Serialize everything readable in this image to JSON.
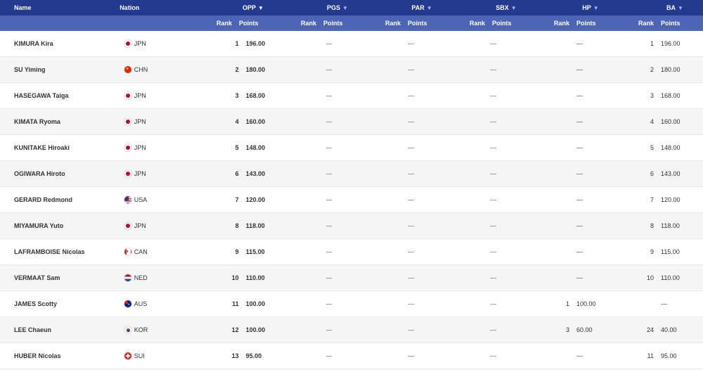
{
  "headers": {
    "name": "Name",
    "nation": "Nation",
    "events": [
      {
        "key": "OPP",
        "label": "OPP",
        "arrow": "▼",
        "active": true
      },
      {
        "key": "PGS",
        "label": "PGS",
        "arrow": "▼",
        "active": false
      },
      {
        "key": "PAR",
        "label": "PAR",
        "arrow": "▼",
        "active": false
      },
      {
        "key": "SBX",
        "label": "SBX",
        "arrow": "▼",
        "active": false
      },
      {
        "key": "HP",
        "label": "HP",
        "arrow": "▼",
        "active": false
      },
      {
        "key": "BA",
        "label": "BA",
        "arrow": "▼",
        "active": false
      }
    ],
    "rank": "Rank",
    "points": "Points"
  },
  "colors": {
    "header_dark": "#233a8f",
    "header_light": "#4e65b6",
    "row_alt": "#f5f5f5"
  },
  "rows": [
    {
      "name": "KIMURA Kira",
      "nation": "JPN",
      "flag": "jpn-flag-icon",
      "opp": [
        "1",
        "196.00"
      ],
      "pgs": "---",
      "par": "---",
      "sbx": "---",
      "hp": [
        "",
        "---"
      ],
      "ba": [
        "1",
        "196.00"
      ]
    },
    {
      "name": "SU Yiming",
      "nation": "CHN",
      "flag": "chn-flag-icon",
      "opp": [
        "2",
        "180.00"
      ],
      "pgs": "---",
      "par": "---",
      "sbx": "---",
      "hp": [
        "",
        "---"
      ],
      "ba": [
        "2",
        "180.00"
      ]
    },
    {
      "name": "HASEGAWA Taiga",
      "nation": "JPN",
      "flag": "jpn-flag-icon",
      "opp": [
        "3",
        "168.00"
      ],
      "pgs": "---",
      "par": "---",
      "sbx": "---",
      "hp": [
        "",
        "---"
      ],
      "ba": [
        "3",
        "168.00"
      ]
    },
    {
      "name": "KIMATA Ryoma",
      "nation": "JPN",
      "flag": "jpn-flag-icon",
      "opp": [
        "4",
        "160.00"
      ],
      "pgs": "---",
      "par": "---",
      "sbx": "---",
      "hp": [
        "",
        "---"
      ],
      "ba": [
        "4",
        "160.00"
      ]
    },
    {
      "name": "KUNITAKE Hiroaki",
      "nation": "JPN",
      "flag": "jpn-flag-icon",
      "opp": [
        "5",
        "148.00"
      ],
      "pgs": "---",
      "par": "---",
      "sbx": "---",
      "hp": [
        "",
        "---"
      ],
      "ba": [
        "5",
        "148.00"
      ]
    },
    {
      "name": "OGIWARA Hiroto",
      "nation": "JPN",
      "flag": "jpn-flag-icon",
      "opp": [
        "6",
        "143.00"
      ],
      "pgs": "---",
      "par": "---",
      "sbx": "---",
      "hp": [
        "",
        "---"
      ],
      "ba": [
        "6",
        "143.00"
      ]
    },
    {
      "name": "GERARD Redmond",
      "nation": "USA",
      "flag": "usa-flag-icon",
      "opp": [
        "7",
        "120.00"
      ],
      "pgs": "---",
      "par": "---",
      "sbx": "---",
      "hp": [
        "",
        "---"
      ],
      "ba": [
        "7",
        "120.00"
      ]
    },
    {
      "name": "MIYAMURA Yuto",
      "nation": "JPN",
      "flag": "jpn-flag-icon",
      "opp": [
        "8",
        "118.00"
      ],
      "pgs": "---",
      "par": "---",
      "sbx": "---",
      "hp": [
        "",
        "---"
      ],
      "ba": [
        "8",
        "118.00"
      ]
    },
    {
      "name": "LAFRAMBOISE Nicolas",
      "nation": "CAN",
      "flag": "can-flag-icon",
      "opp": [
        "9",
        "115.00"
      ],
      "pgs": "---",
      "par": "---",
      "sbx": "---",
      "hp": [
        "",
        "---"
      ],
      "ba": [
        "9",
        "115.00"
      ]
    },
    {
      "name": "VERMAAT Sam",
      "nation": "NED",
      "flag": "ned-flag-icon",
      "opp": [
        "10",
        "110.00"
      ],
      "pgs": "---",
      "par": "---",
      "sbx": "---",
      "hp": [
        "",
        "---"
      ],
      "ba": [
        "10",
        "110.00"
      ]
    },
    {
      "name": "JAMES Scotty",
      "nation": "AUS",
      "flag": "aus-flag-icon",
      "opp": [
        "11",
        "100.00"
      ],
      "pgs": "---",
      "par": "---",
      "sbx": "---",
      "hp": [
        "1",
        "100.00"
      ],
      "ba": [
        "",
        "---"
      ]
    },
    {
      "name": "LEE Chaeun",
      "nation": "KOR",
      "flag": "kor-flag-icon",
      "opp": [
        "12",
        "100.00"
      ],
      "pgs": "---",
      "par": "---",
      "sbx": "---",
      "hp": [
        "3",
        "60.00"
      ],
      "ba": [
        "24",
        "40.00"
      ]
    },
    {
      "name": "HUBER Nicolas",
      "nation": "SUI",
      "flag": "sui-flag-icon",
      "opp": [
        "13",
        "95.00"
      ],
      "pgs": "---",
      "par": "---",
      "sbx": "---",
      "hp": [
        "",
        "---"
      ],
      "ba": [
        "11",
        "95.00"
      ]
    }
  ]
}
